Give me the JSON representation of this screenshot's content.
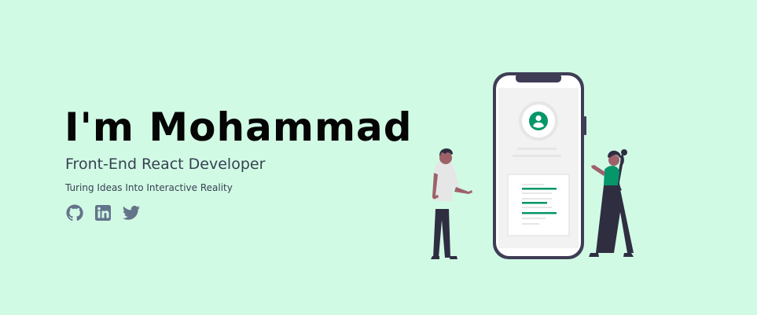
{
  "hero": {
    "title": "I'm Mohammad",
    "subtitle": "Front-End React Developer",
    "tagline": "Turing Ideas Into Interactive Reality"
  },
  "social": [
    {
      "name": "github",
      "icon": "github-icon"
    },
    {
      "name": "linkedin",
      "icon": "linkedin-icon"
    },
    {
      "name": "twitter",
      "icon": "twitter-icon"
    }
  ],
  "colors": {
    "background": "#d1fae5",
    "social_icon": "#64748b",
    "accent": "#059669",
    "phone_frame": "#3f3d56"
  }
}
